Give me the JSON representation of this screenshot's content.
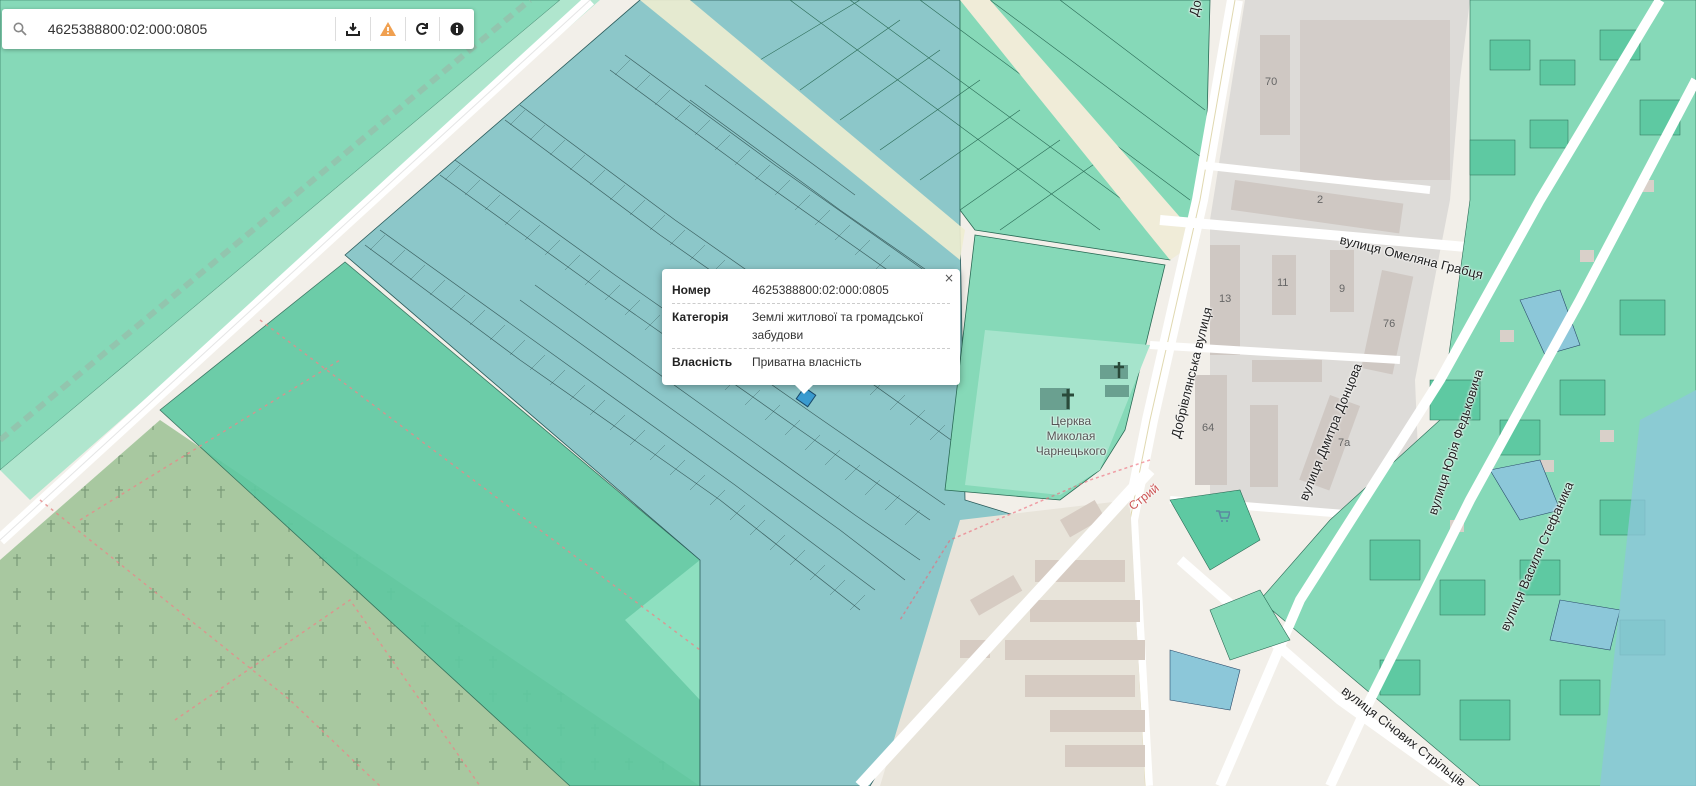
{
  "search": {
    "value": "4625388800:02:000:0805"
  },
  "toolbar": {
    "download_icon": "download-icon",
    "warning_icon": "warning-icon",
    "refresh_icon": "refresh-icon",
    "info_icon": "info-icon",
    "warning_color": "#f0a050"
  },
  "popup": {
    "close": "×",
    "rows": [
      {
        "key": "Номер",
        "value": "4625388800:02:000:0805"
      },
      {
        "key": "Категорія",
        "value": "Землі житлової та громадської забудови"
      },
      {
        "key": "Власність",
        "value": "Приватна власність"
      }
    ]
  },
  "map": {
    "streets": {
      "hrabtsia": "вулиця Омеляна Грабця",
      "dobrivlianska": "Добрівлянська вулиця",
      "dontsova": "вулиця Дмитра Донцова",
      "fedkovycha": "вулиця Юрія Федьковича",
      "stefanyka": "вулиця Василя Стефаника",
      "sichovykh": "вулиця Січових Стрільців",
      "stryi": "Стрий",
      "do": "До"
    },
    "church": {
      "line1": "Церква",
      "line2": "Миколая",
      "line3": "Чарнецького"
    },
    "building_numbers": {
      "n70": "70",
      "n2": "2",
      "n13": "13",
      "n11": "11",
      "n9": "9",
      "n76": "76",
      "n64": "64",
      "n7a": "7а"
    },
    "colors": {
      "background": "#f2efe9",
      "parcel_green": "#7dd8b4",
      "parcel_blue": "#8cc7c9",
      "parcel_stroke": "#2a5a4a",
      "cemetery": "#a8c8a0",
      "building": "#d9d0c9",
      "road": "#ffffff"
    }
  }
}
